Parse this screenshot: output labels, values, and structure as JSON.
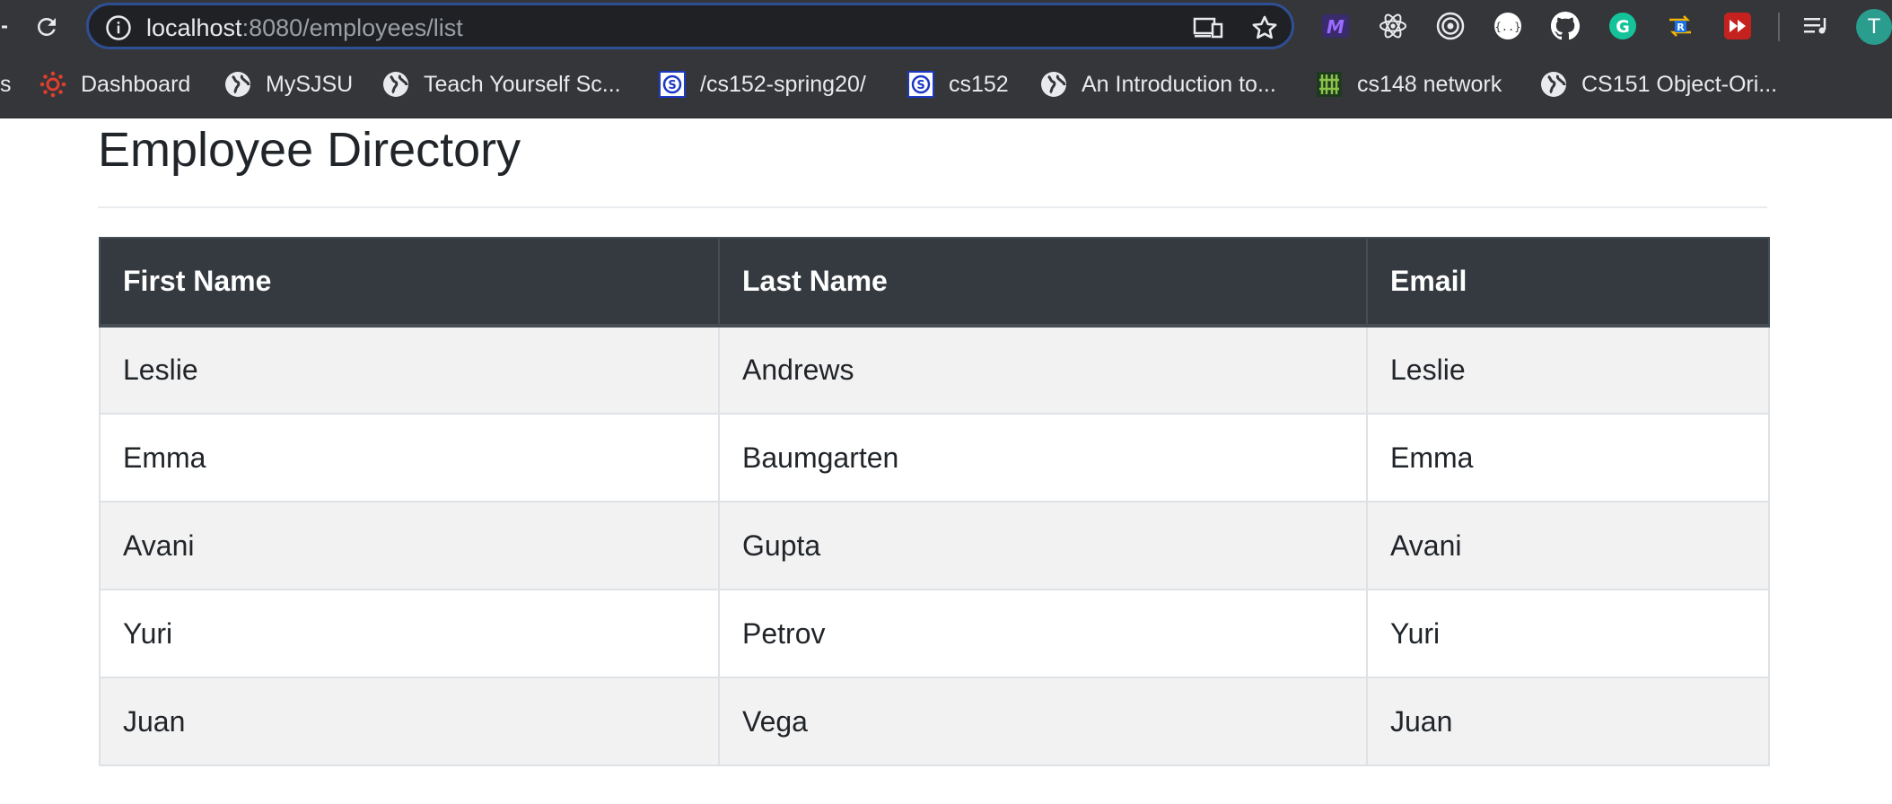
{
  "browser": {
    "url": {
      "host": "localhost",
      "rest": ":8080/employees/list"
    },
    "toolbar_partial_label": "s",
    "profile_initial": "T",
    "extensions": [
      {
        "name": "m-extension-icon",
        "color": "#7b3fe4"
      },
      {
        "name": "react-devtools-icon",
        "color": "#e8eaed"
      },
      {
        "name": "target-extension-icon",
        "color": "#e8eaed"
      },
      {
        "name": "json-viewer-icon",
        "color": "#ffffff"
      },
      {
        "name": "github-icon",
        "color": "#ffffff"
      },
      {
        "name": "grammarly-icon",
        "color": "#15c39a"
      },
      {
        "name": "r-extension-icon",
        "color": "#f4b400"
      },
      {
        "name": "fast-forward-icon",
        "color": "#d93025"
      }
    ],
    "bookmarks": [
      {
        "label": "Dashboard",
        "icon": "canvas-icon"
      },
      {
        "label": "MySJSU",
        "icon": "globe-icon"
      },
      {
        "label": "Teach Yourself Sc...",
        "icon": "globe-icon"
      },
      {
        "label": "/cs152-spring20/",
        "icon": "sjsu-icon"
      },
      {
        "label": "cs152",
        "icon": "sjsu-icon"
      },
      {
        "label": "An Introduction to...",
        "icon": "globe-icon"
      },
      {
        "label": "cs148 network",
        "icon": "cs148-icon"
      },
      {
        "label": "CS151 Object-Ori...",
        "icon": "globe-icon"
      }
    ]
  },
  "page": {
    "title": "Employee Directory",
    "table": {
      "headers": [
        "First Name",
        "Last Name",
        "Email"
      ],
      "rows": [
        [
          "Leslie",
          "Andrews",
          "Leslie"
        ],
        [
          "Emma",
          "Baumgarten",
          "Emma"
        ],
        [
          "Avani",
          "Gupta",
          "Avani"
        ],
        [
          "Yuri",
          "Petrov",
          "Yuri"
        ],
        [
          "Juan",
          "Vega",
          "Juan"
        ]
      ]
    }
  },
  "colors": {
    "chrome_bg": "#35363a",
    "table_header_bg": "#343a40",
    "stripe_bg": "#f2f2f2",
    "text": "#212529"
  }
}
